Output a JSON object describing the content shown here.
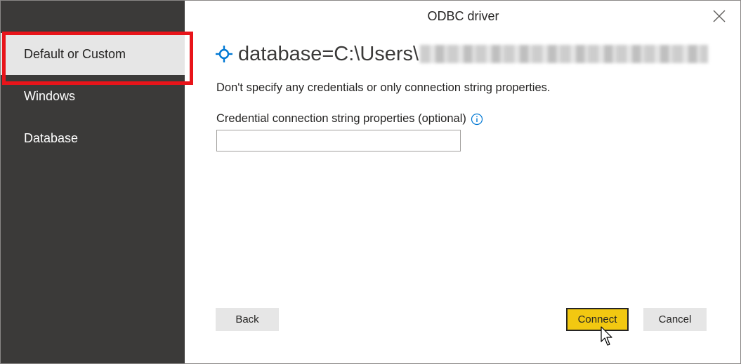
{
  "dialog": {
    "title": "ODBC driver",
    "close_icon": "close-icon"
  },
  "sidebar": {
    "items": [
      {
        "label": "Default or Custom",
        "selected": true
      },
      {
        "label": "Windows",
        "selected": false
      },
      {
        "label": "Database",
        "selected": false
      }
    ]
  },
  "main": {
    "heading_icon": "connection-node-icon",
    "heading_text": "database=C:\\Users\\",
    "description": "Don't specify any credentials or only connection string properties.",
    "field_label": "Credential connection string properties (optional)",
    "field_value": "",
    "info_icon": "info-icon"
  },
  "buttons": {
    "back_label": "Back",
    "connect_label": "Connect",
    "cancel_label": "Cancel"
  },
  "colors": {
    "sidebar_bg": "#3b3a39",
    "selected_item_bg": "#e6e6e6",
    "highlight_border": "#e8141a",
    "primary_button": "#f2c811",
    "accent_icon": "#0078d4"
  }
}
